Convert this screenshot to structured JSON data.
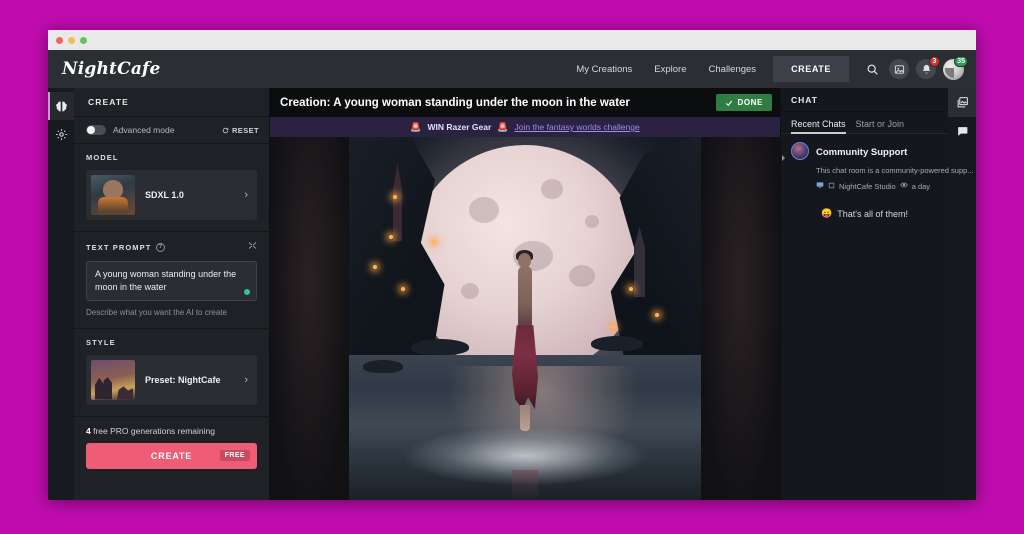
{
  "desktop": {
    "background_color": "#c00caf"
  },
  "window": {
    "titlebar_dots": [
      "close",
      "minimize",
      "maximize"
    ]
  },
  "topbar": {
    "logo": "NightCafe",
    "nav": [
      {
        "label": "My Creations",
        "name": "nav-my-creations"
      },
      {
        "label": "Explore",
        "name": "nav-explore"
      },
      {
        "label": "Challenges",
        "name": "nav-challenges"
      }
    ],
    "create_button": "CREATE",
    "icons": {
      "search": "search-icon",
      "gallery": "image-card-icon",
      "bell": "bell-icon"
    },
    "bell_badge": "3",
    "avatar_badge": "35"
  },
  "rail": {
    "items": [
      {
        "name": "rail-item-create",
        "icon": "brain-icon",
        "active": true
      },
      {
        "name": "rail-item-settings",
        "icon": "gear-icon",
        "active": false
      }
    ]
  },
  "sidebar": {
    "header": "CREATE",
    "advanced_mode_label": "Advanced mode",
    "advanced_mode_on": false,
    "reset_label": "RESET",
    "model": {
      "title": "MODEL",
      "value": "SDXL 1.0"
    },
    "text_prompt": {
      "title": "TEXT PROMPT",
      "value": "A young woman standing under the moon in the water",
      "hint": "Describe what you want the AI to create"
    },
    "style": {
      "title": "STYLE",
      "value": "Preset: NightCafe"
    },
    "generations_count": "4",
    "generations_text": " free PRO generations remaining",
    "create_label": "CREATE",
    "free_pill": "FREE",
    "create_color": "#ee5d75"
  },
  "center": {
    "creation_title": "Creation: A young woman standing under the moon in the water",
    "done_label": "DONE",
    "done_color": "#2f7d43",
    "challenge": {
      "siren": "🚨",
      "label": "WIN Razer Gear",
      "link": "Join the fantasy worlds challenge"
    },
    "artwork_alt": "A young woman standing under a giant moon in the water with fantasy castles"
  },
  "chat": {
    "header": "CHAT",
    "tabs": [
      {
        "label": "Recent Chats",
        "active": true
      },
      {
        "label": "Start or Join",
        "active": false
      }
    ],
    "item": {
      "name": "Community Support",
      "description": "This chat room is a community-powered supp...",
      "author": "NightCafe Studio",
      "time": "a day"
    },
    "end_emoji": "😛",
    "end_text": "That's all of them!",
    "rail": [
      {
        "name": "chat-rail-gallery",
        "icon": "images-icon",
        "active": true
      },
      {
        "name": "chat-rail-messages",
        "icon": "chat-bubble-icon",
        "active": false
      }
    ]
  }
}
